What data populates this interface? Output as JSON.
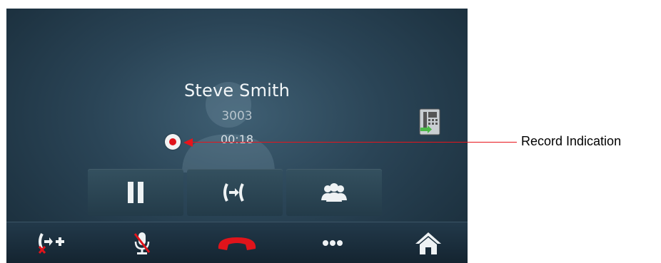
{
  "call": {
    "caller_name": "Steve Smith",
    "caller_number": "3003",
    "timer": "00:18",
    "recording": true
  },
  "actions": [
    {
      "name": "hold",
      "icon": "pause-icon"
    },
    {
      "name": "swap",
      "icon": "call-swap-icon"
    },
    {
      "name": "conference",
      "icon": "conference-icon"
    }
  ],
  "bottom_bar": [
    {
      "name": "transfer",
      "icon": "transfer-add-icon"
    },
    {
      "name": "mute",
      "icon": "mic-muted-icon"
    },
    {
      "name": "end-call",
      "icon": "hang-up-icon"
    },
    {
      "name": "more",
      "icon": "more-icon"
    },
    {
      "name": "home",
      "icon": "home-icon"
    }
  ],
  "annotation": {
    "label": "Record Indication"
  },
  "colors": {
    "accent_red": "#e0141b",
    "screen_bg": "#2a4456",
    "transfer_green": "#4cb848"
  }
}
